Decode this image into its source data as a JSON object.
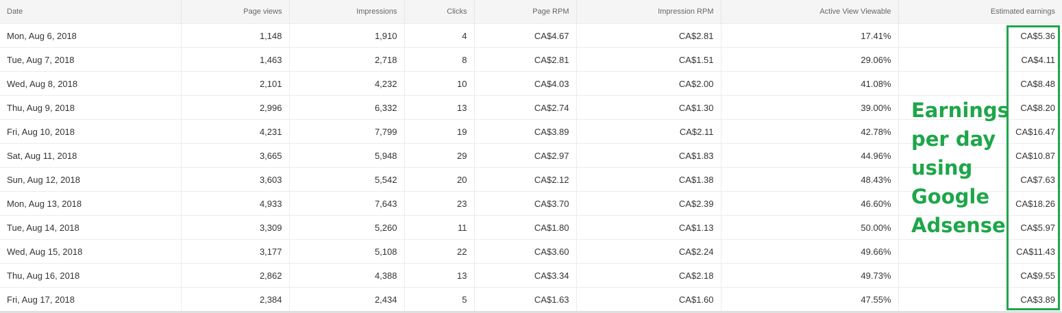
{
  "table": {
    "headers": [
      "Date",
      "Page views",
      "Impressions",
      "Clicks",
      "Page RPM",
      "Impression RPM",
      "Active View Viewable",
      "Estimated earnings"
    ],
    "rows": [
      [
        "Mon, Aug 6, 2018",
        "1,148",
        "1,910",
        "4",
        "CA$4.67",
        "CA$2.81",
        "17.41%",
        "CA$5.36"
      ],
      [
        "Tue, Aug 7, 2018",
        "1,463",
        "2,718",
        "8",
        "CA$2.81",
        "CA$1.51",
        "29.06%",
        "CA$4.11"
      ],
      [
        "Wed, Aug 8, 2018",
        "2,101",
        "4,232",
        "10",
        "CA$4.03",
        "CA$2.00",
        "41.08%",
        "CA$8.48"
      ],
      [
        "Thu, Aug 9, 2018",
        "2,996",
        "6,332",
        "13",
        "CA$2.74",
        "CA$1.30",
        "39.00%",
        "CA$8.20"
      ],
      [
        "Fri, Aug 10, 2018",
        "4,231",
        "7,799",
        "19",
        "CA$3.89",
        "CA$2.11",
        "42.78%",
        "CA$16.47"
      ],
      [
        "Sat, Aug 11, 2018",
        "3,665",
        "5,948",
        "29",
        "CA$2.97",
        "CA$1.83",
        "44.96%",
        "CA$10.87"
      ],
      [
        "Sun, Aug 12, 2018",
        "3,603",
        "5,542",
        "20",
        "CA$2.12",
        "CA$1.38",
        "48.43%",
        "CA$7.63"
      ],
      [
        "Mon, Aug 13, 2018",
        "4,933",
        "7,643",
        "23",
        "CA$3.70",
        "CA$2.39",
        "46.60%",
        "CA$18.26"
      ],
      [
        "Tue, Aug 14, 2018",
        "3,309",
        "5,260",
        "11",
        "CA$1.80",
        "CA$1.13",
        "50.00%",
        "CA$5.97"
      ],
      [
        "Wed, Aug 15, 2018",
        "3,177",
        "5,108",
        "22",
        "CA$3.60",
        "CA$2.24",
        "49.66%",
        "CA$11.43"
      ],
      [
        "Thu, Aug 16, 2018",
        "2,862",
        "4,388",
        "13",
        "CA$3.34",
        "CA$2.18",
        "49.73%",
        "CA$9.55"
      ],
      [
        "Fri, Aug 17, 2018",
        "2,384",
        "2,434",
        "5",
        "CA$1.63",
        "CA$1.60",
        "47.55%",
        "CA$3.89"
      ]
    ]
  },
  "annotation": {
    "lines": [
      "Earnings",
      "per day",
      "using",
      "Google",
      "Adsense"
    ],
    "color": "#1ea64a"
  }
}
